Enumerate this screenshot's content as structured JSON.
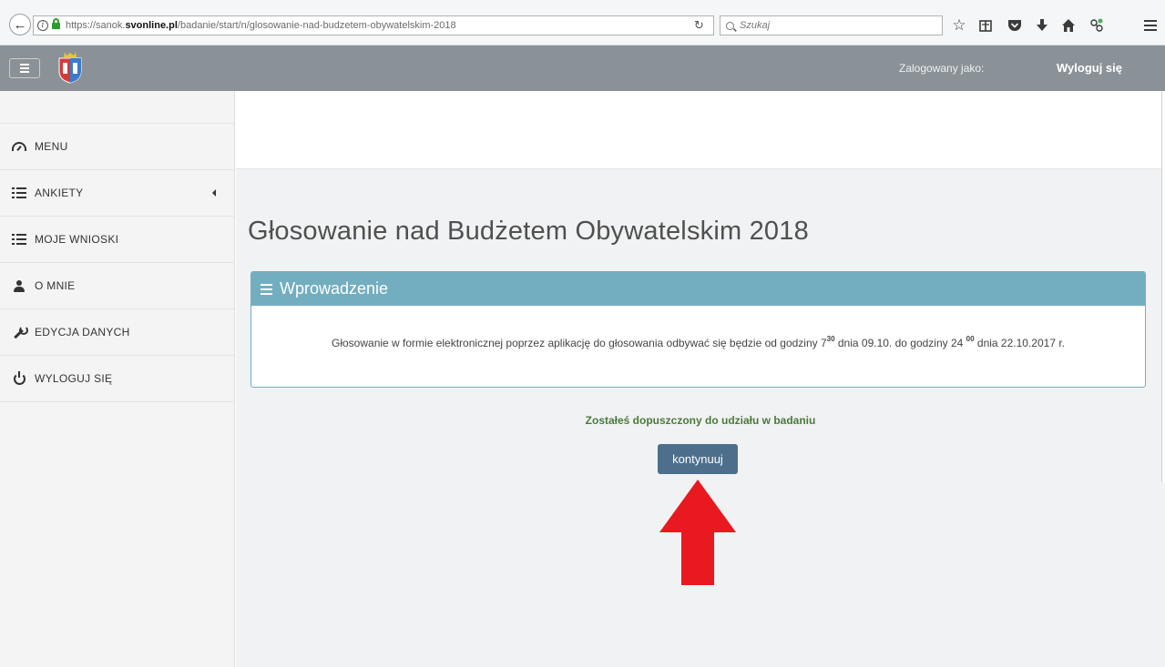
{
  "browser": {
    "url_prefix": "https://sanok.",
    "url_domain": "svonline.pl",
    "url_path": "/badanie/start/n/glosowanie-nad-budzetem-obywatelskim-2018",
    "search_placeholder": "Szukaj",
    "toolbar_icons": [
      "bookmark-star-icon",
      "reading-list-icon",
      "pocket-icon",
      "download-icon",
      "home-icon",
      "extension-icon",
      "menu-icon"
    ]
  },
  "header": {
    "logged_in_label": "Zalogowany jako:",
    "logout_label": "Wyloguj się",
    "header_color": "#8b9297"
  },
  "sidebar": {
    "items": [
      {
        "label": "MENU",
        "icon": "dashboard-icon"
      },
      {
        "label": "ANKIETY",
        "icon": "list-icon"
      },
      {
        "label": "MOJE WNIOSKI",
        "icon": "list-icon"
      },
      {
        "label": "O MNIE",
        "icon": "user-icon"
      },
      {
        "label": "EDYCJA DANYCH",
        "icon": "wrench-icon"
      },
      {
        "label": "WYLOGUJ SIĘ",
        "icon": "power-icon"
      }
    ]
  },
  "main": {
    "title": "Głosowanie nad Budżetem Obywatelskim 2018",
    "panel": {
      "heading": "Wprowadzenie",
      "text_part1": "Głosowanie w formie elektronicznej poprzez aplikację do głosowania odbywać się będzie od godziny 7",
      "sup1": "30",
      "text_part2": " dnia 09.10. do godziny 24 ",
      "sup2": "00",
      "text_part3": " dnia 22.10.2017 r.",
      "accent_color": "#72aec0"
    },
    "status_message": "Zostałeś dopuszczony do udziału w badaniu",
    "continue_label": "kontynuuj",
    "button_color": "#4d6f8c",
    "arrow_color": "#e8191f"
  }
}
